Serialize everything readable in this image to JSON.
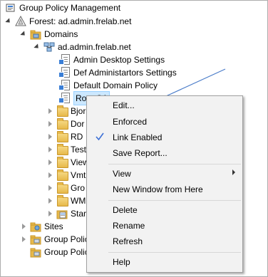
{
  "tree": {
    "root_label": "Group Policy Management",
    "forest_label": "Forest: ad.admin.frelab.net",
    "domains_label": "Domains",
    "domain_label": "ad.admin.frelab.net",
    "gpos": [
      "Admin Desktop Settings",
      "Def Administartors Settings",
      "Default Domain Policy",
      "Root CA"
    ],
    "ous": [
      "Bjor",
      "Dor",
      "RD",
      "Test",
      "View",
      "Vmt",
      "Gro",
      "WM",
      "Star"
    ],
    "sites_label": "Sites",
    "gp_modeling_label": "Group Polic",
    "gp_results_label": "Group Polic"
  },
  "context_menu": {
    "items": {
      "edit": "Edit...",
      "enforced": "Enforced",
      "link_enabled": "Link Enabled",
      "save_report": "Save Report...",
      "view": "View",
      "new_window": "New Window from Here",
      "delete": "Delete",
      "rename": "Rename",
      "refresh": "Refresh",
      "help": "Help"
    },
    "link_enabled_checked": true
  },
  "colors": {
    "selection": "#cce8ff",
    "menu_hover": "#91c9f7",
    "check": "#3b6fd6",
    "annotation_arrow": "#4a7cc9"
  }
}
